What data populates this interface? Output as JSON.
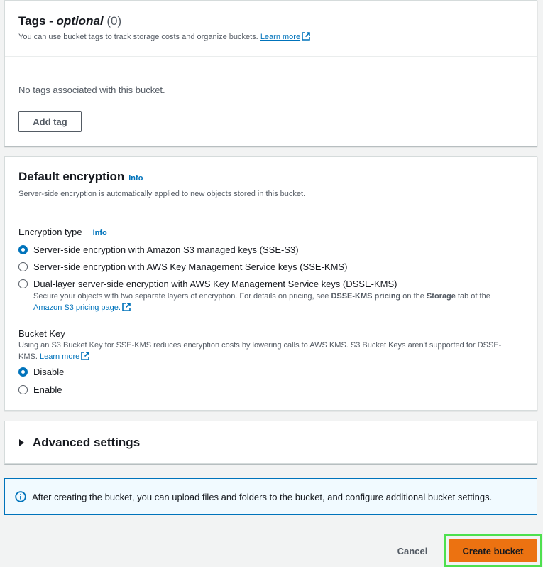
{
  "tags": {
    "title": "Tags - ",
    "title_optional": "optional",
    "count": "(0)",
    "description": "You can use bucket tags to track storage costs and organize buckets.",
    "learn_more": "Learn more",
    "empty_text": "No tags associated with this bucket.",
    "add_tag": "Add tag"
  },
  "encryption": {
    "title": "Default encryption",
    "info": "Info",
    "description": "Server-side encryption is automatically applied to new objects stored in this bucket.",
    "type_label": "Encryption type",
    "type_info": "Info",
    "options": [
      {
        "label": "Server-side encryption with Amazon S3 managed keys (SSE-S3)",
        "checked": true
      },
      {
        "label": "Server-side encryption with AWS Key Management Service keys (SSE-KMS)",
        "checked": false
      },
      {
        "label": "Dual-layer server-side encryption with AWS Key Management Service keys (DSSE-KMS)",
        "checked": false
      }
    ],
    "dsse_desc_1": "Secure your objects with two separate layers of encryption. For details on pricing, see ",
    "dsse_desc_bold1": "DSSE-KMS pricing",
    "dsse_desc_2": " on the ",
    "dsse_desc_bold2": "Storage",
    "dsse_desc_3": " tab of the",
    "pricing_link": "Amazon S3 pricing page.",
    "bucket_key_label": "Bucket Key",
    "bucket_key_desc": "Using an S3 Bucket Key for SSE-KMS reduces encryption costs by lowering calls to AWS KMS. S3 Bucket Keys aren't supported for DSSE-KMS.",
    "bucket_key_learn_more": "Learn more",
    "bucket_key_options": [
      {
        "label": "Disable",
        "checked": true
      },
      {
        "label": "Enable",
        "checked": false
      }
    ]
  },
  "advanced": {
    "title": "Advanced settings"
  },
  "alert": {
    "text": "After creating the bucket, you can upload files and folders to the bucket, and configure additional bucket settings."
  },
  "actions": {
    "cancel": "Cancel",
    "create": "Create bucket"
  },
  "colors": {
    "link": "#0073bb",
    "primary": "#ec7211",
    "highlight": "#4ee04e"
  }
}
